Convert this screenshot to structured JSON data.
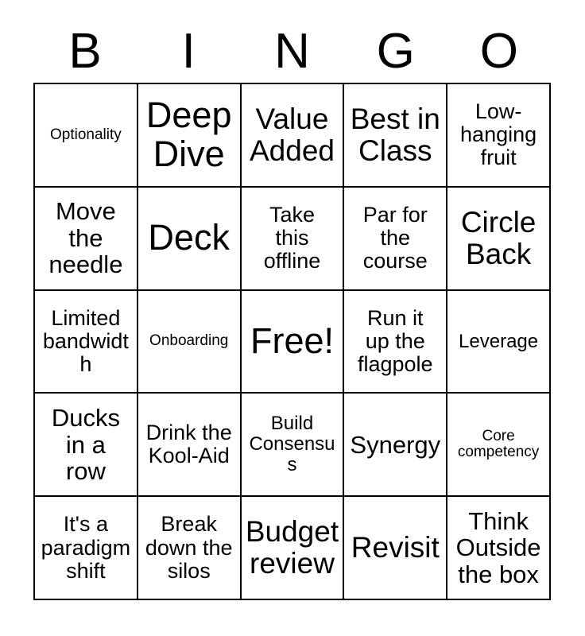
{
  "card": {
    "header_letters": [
      "B",
      "I",
      "N",
      "G",
      "O"
    ],
    "columns": 5,
    "rows": 5,
    "border_color": "#000000",
    "background_color": "#ffffff",
    "text_color": "#000000"
  },
  "cells": [
    {
      "text": "Optionality",
      "size": "sz-xs",
      "row": 1,
      "col": 1
    },
    {
      "text": "Deep\nDive",
      "size": "sz-xxl",
      "row": 1,
      "col": 2
    },
    {
      "text": "Value\nAdded",
      "size": "sz-xl",
      "row": 1,
      "col": 3
    },
    {
      "text": "Best in\nClass",
      "size": "sz-xl",
      "row": 1,
      "col": 4
    },
    {
      "text": "Low-\nhanging\nfruit",
      "size": "sz-m",
      "row": 1,
      "col": 5
    },
    {
      "text": "Move\nthe\nneedle",
      "size": "sz-l",
      "row": 2,
      "col": 1
    },
    {
      "text": "Deck",
      "size": "sz-xxl",
      "row": 2,
      "col": 2
    },
    {
      "text": "Take\nthis\noffline",
      "size": "sz-m",
      "row": 2,
      "col": 3
    },
    {
      "text": "Par for\nthe\ncourse",
      "size": "sz-m",
      "row": 2,
      "col": 4
    },
    {
      "text": "Circle\nBack",
      "size": "sz-xl",
      "row": 2,
      "col": 5
    },
    {
      "text": "Limited\nbandwidth",
      "size": "sz-m",
      "row": 3,
      "col": 1
    },
    {
      "text": "Onboarding",
      "size": "sz-xs",
      "row": 3,
      "col": 2
    },
    {
      "text": "Free!",
      "size": "sz-xxl",
      "row": 3,
      "col": 3
    },
    {
      "text": "Run it\nup the\nflagpole",
      "size": "sz-m",
      "row": 3,
      "col": 4
    },
    {
      "text": "Leverage",
      "size": "sz-s",
      "row": 3,
      "col": 5
    },
    {
      "text": "Ducks\nin a\nrow",
      "size": "sz-l",
      "row": 4,
      "col": 1
    },
    {
      "text": "Drink the\nKool-Aid",
      "size": "sz-m",
      "row": 4,
      "col": 2
    },
    {
      "text": "Build\nConsensus",
      "size": "sz-s",
      "row": 4,
      "col": 3
    },
    {
      "text": "Synergy",
      "size": "sz-l",
      "row": 4,
      "col": 4
    },
    {
      "text": "Core\ncompetency",
      "size": "sz-xs",
      "row": 4,
      "col": 5
    },
    {
      "text": "It's a\nparadigm\nshift",
      "size": "sz-m",
      "row": 5,
      "col": 1
    },
    {
      "text": "Break\ndown the\nsilos",
      "size": "sz-m",
      "row": 5,
      "col": 2
    },
    {
      "text": "Budget\nreview",
      "size": "sz-xl",
      "row": 5,
      "col": 3
    },
    {
      "text": "Revisit",
      "size": "sz-xl",
      "row": 5,
      "col": 4
    },
    {
      "text": "Think\nOutside\nthe box",
      "size": "sz-l",
      "row": 5,
      "col": 5
    }
  ]
}
